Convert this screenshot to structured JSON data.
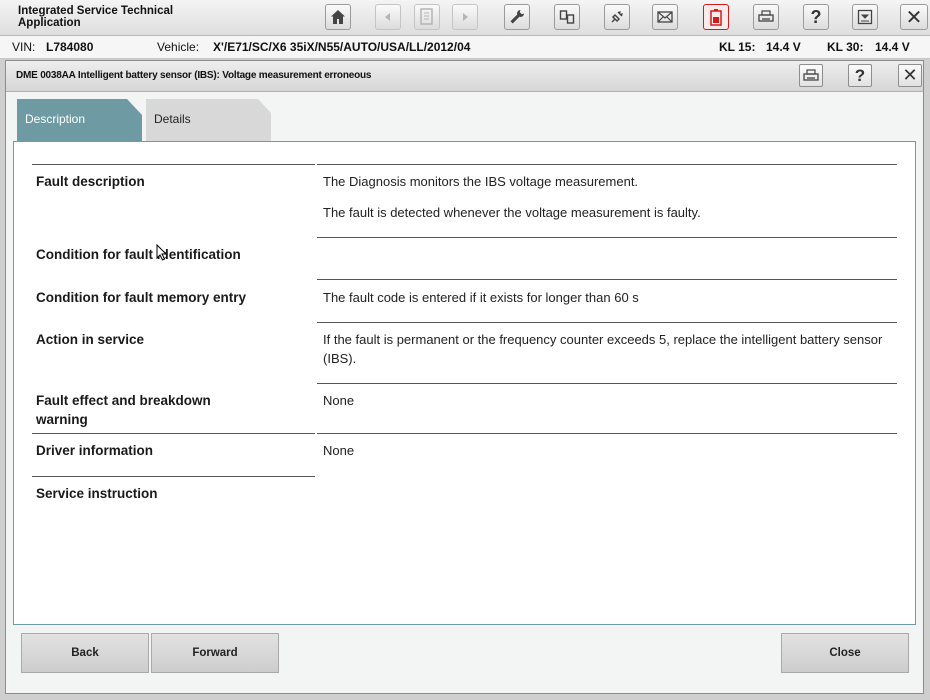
{
  "app": {
    "title": "Integrated Service Technical\nApplication"
  },
  "toolbar": {
    "buttons": [
      {
        "name": "home",
        "icon": "home-icon"
      },
      {
        "name": "back",
        "icon": "arrow-left-icon"
      },
      {
        "name": "document",
        "icon": "document-icon"
      },
      {
        "name": "forward",
        "icon": "arrow-right-icon"
      },
      {
        "name": "service",
        "icon": "wrench-icon"
      },
      {
        "name": "vehicle-management",
        "icon": "vehicle-data-icon"
      },
      {
        "name": "connection",
        "icon": "plug-icon"
      },
      {
        "name": "messages",
        "icon": "envelope-icon"
      },
      {
        "name": "battery",
        "icon": "battery-icon"
      },
      {
        "name": "print",
        "icon": "printer-icon"
      },
      {
        "name": "help",
        "icon": "help-icon"
      },
      {
        "name": "minimize",
        "icon": "minimize-icon"
      },
      {
        "name": "exit",
        "icon": "close-icon"
      }
    ],
    "help_glyph": "?",
    "close_glyph": "✕"
  },
  "vehicle": {
    "vin_label": "VIN:",
    "vin": "L784080",
    "vehicle_label": "Vehicle:",
    "vehicle": "X'/E71/SC/X6 35iX/N55/AUTO/USA/LL/2012/04",
    "kl15_label": "KL 15:",
    "kl15": "14.4 V",
    "kl30_label": "KL 30:",
    "kl30": "14.4 V"
  },
  "dialog": {
    "title": "DME 0038AA Intelligent battery sensor (IBS): Voltage measurement erroneous",
    "help_glyph": "?",
    "close_glyph": "✕",
    "tabs": [
      {
        "label": "Description",
        "active": true
      },
      {
        "label": "Details",
        "active": false
      }
    ],
    "rows": [
      {
        "label": "Fault description",
        "value": "The Diagnosis monitors the IBS voltage measurement.",
        "value2": "The fault is detected whenever the voltage measurement is faulty."
      },
      {
        "label": "Condition for fault identification",
        "value": ""
      },
      {
        "label": "Condition for fault memory entry",
        "value": "The fault code is entered if it exists for longer than 60 s"
      },
      {
        "label": "Action in service",
        "value": "If the fault is permanent or the frequency counter exceeds 5, replace the intelligent battery sensor (IBS)."
      },
      {
        "label": "Fault effect and breakdown warning",
        "value": "None"
      },
      {
        "label": "Driver information",
        "value": "None"
      },
      {
        "label": "Service instruction",
        "value": ""
      }
    ],
    "buttons": {
      "back": "Back",
      "forward": "Forward",
      "close": "Close"
    }
  },
  "colors": {
    "accent": "#6e9aa3",
    "alert": "#d01c1c"
  }
}
